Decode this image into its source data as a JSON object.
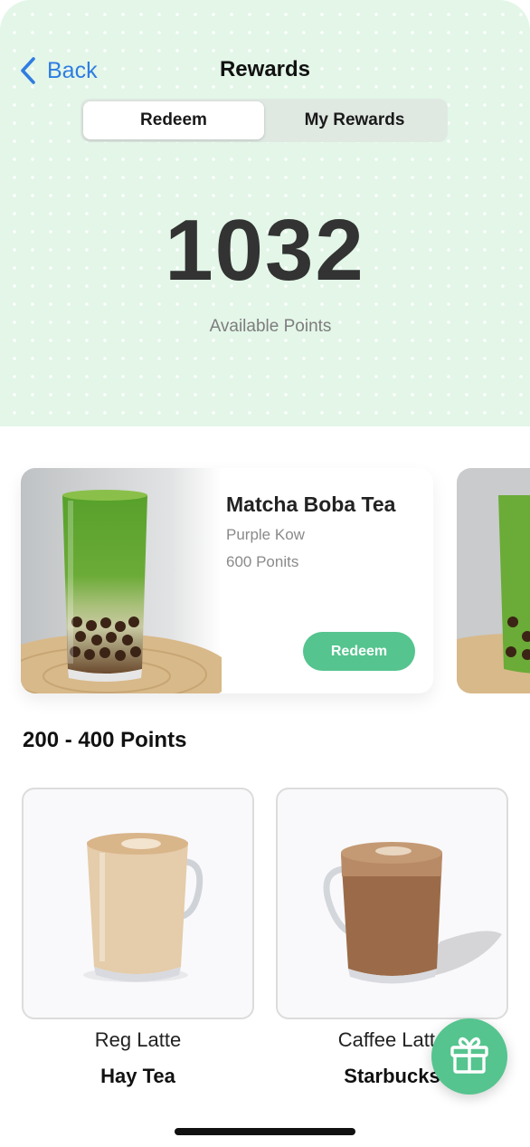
{
  "header": {
    "back_label": "Back",
    "title": "Rewards"
  },
  "tabs": [
    {
      "label": "Redeem",
      "active": true
    },
    {
      "label": "My Rewards",
      "active": false
    }
  ],
  "points": {
    "value": "1032",
    "label": "Available Points"
  },
  "featured": [
    {
      "name": "Matcha Boba Tea",
      "vendor": "Purple Kow",
      "points": "600 Ponits",
      "action": "Redeem"
    }
  ],
  "section": {
    "title": "200 - 400 Points",
    "items": [
      {
        "name": "Reg Latte",
        "vendor": "Hay Tea"
      },
      {
        "name": "Caffee Latte",
        "vendor": "Starbucks"
      }
    ]
  },
  "colors": {
    "accent": "#55c48e",
    "link": "#2f7de1",
    "hero_bg": "#e3f6e8"
  },
  "icons": {
    "back": "chevron-left-icon",
    "fab": "gift-icon"
  }
}
